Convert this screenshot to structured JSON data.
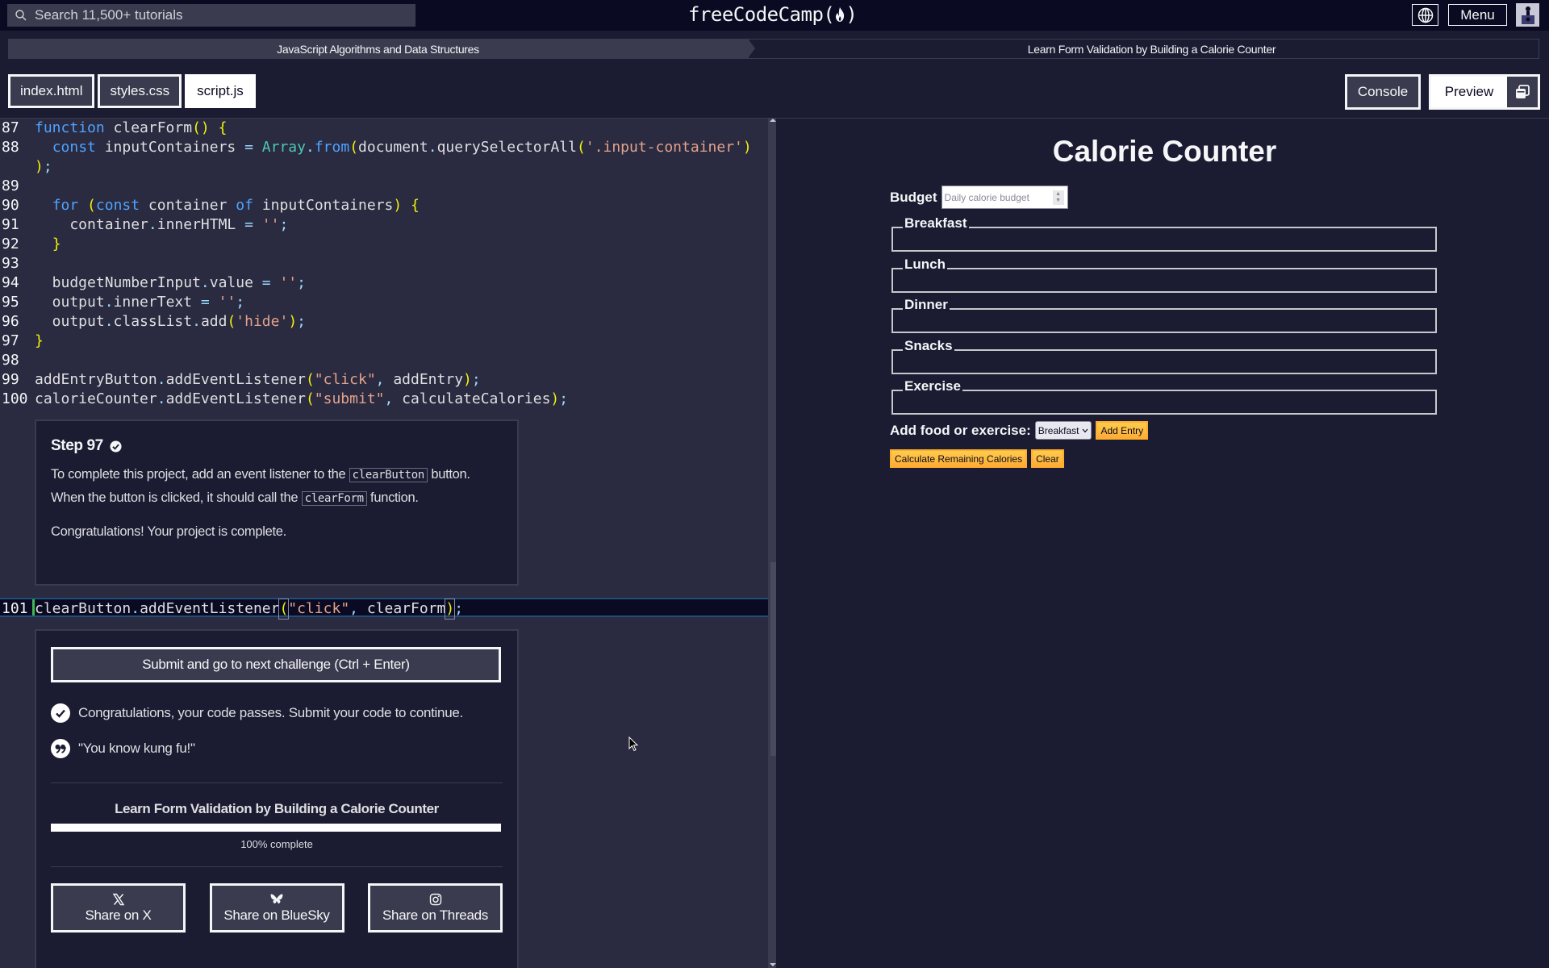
{
  "header": {
    "search_placeholder": "Search 11,500+ tutorials",
    "logo_text": "freeCodeCamp(",
    "logo_close": ")",
    "menu_label": "Menu"
  },
  "breadcrumb": {
    "superblock": "JavaScript Algorithms and Data Structures",
    "block": "Learn Form Validation by Building a Calorie Counter"
  },
  "tabs": {
    "files": [
      "index.html",
      "styles.css",
      "script.js"
    ],
    "active_file": "script.js",
    "console_label": "Console",
    "preview_label": "Preview"
  },
  "editor": {
    "lines": [
      {
        "num": "87",
        "text": "function clearForm() {"
      },
      {
        "num": "88",
        "text": "  const inputContainers = Array.from(document.querySelectorAll('.input-container')"
      },
      {
        "num": "",
        "text": ");"
      },
      {
        "num": "89",
        "text": ""
      },
      {
        "num": "90",
        "text": "  for (const container of inputContainers) {"
      },
      {
        "num": "91",
        "text": "    container.innerHTML = '';"
      },
      {
        "num": "92",
        "text": "  }"
      },
      {
        "num": "93",
        "text": ""
      },
      {
        "num": "94",
        "text": "  budgetNumberInput.value = '';"
      },
      {
        "num": "95",
        "text": "  output.innerText = '';"
      },
      {
        "num": "96",
        "text": "  output.classList.add('hide');"
      },
      {
        "num": "97",
        "text": "}"
      },
      {
        "num": "98",
        "text": ""
      },
      {
        "num": "99",
        "text": "addEntryButton.addEventListener(\"click\", addEntry);"
      },
      {
        "num": "100",
        "text": "calorieCounter.addEventListener(\"submit\", calculateCalories);"
      }
    ],
    "active_line": {
      "num": "101",
      "text": "clearButton.addEventListener(\"click\", clearForm);"
    }
  },
  "description": {
    "step_title": "Step 97",
    "text_before_code1": "To complete this project, add an event listener to the ",
    "code1": "clearButton",
    "text_between": " button. When the button is clicked, it should call the ",
    "code2": "clearForm",
    "text_after": " function.",
    "congrats": "Congratulations! Your project is complete."
  },
  "actions": {
    "submit_label": "Submit and go to next challenge (Ctrl + Enter)",
    "pass_message": "Congratulations, your code passes. Submit your code to continue.",
    "quote": "\"You know kung fu!\"",
    "project_title": "Learn Form Validation by Building a Calorie Counter",
    "progress_percent": 100,
    "progress_label": "100% complete",
    "share": [
      {
        "label": "Share on X",
        "icon": "x-logo-icon"
      },
      {
        "label": "Share on BlueSky",
        "icon": "bluesky-butterfly-icon"
      },
      {
        "label": "Share on Threads",
        "icon": "threads-logo-icon"
      }
    ]
  },
  "preview": {
    "title": "Calorie Counter",
    "budget_label": "Budget",
    "budget_placeholder": "Daily calorie budget",
    "fieldsets": [
      "Breakfast",
      "Lunch",
      "Dinner",
      "Snacks",
      "Exercise"
    ],
    "add_label": "Add food or exercise:",
    "select_value": "Breakfast",
    "add_entry_label": "Add Entry",
    "calculate_label": "Calculate Remaining Calories",
    "clear_label": "Clear"
  }
}
